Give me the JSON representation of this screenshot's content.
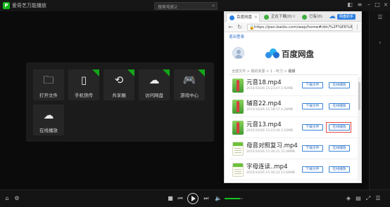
{
  "player": {
    "title": "爱奇艺万能播放",
    "title_caret": "⌄",
    "search_placeholder": "搜索电影2",
    "tiles": [
      {
        "label": "打开文件",
        "icon": "🗀",
        "new": false
      },
      {
        "label": "手机快传",
        "icon": "▯",
        "new": true
      },
      {
        "label": "共享圈",
        "icon": "⟲",
        "new": true
      },
      {
        "label": "访问网盘",
        "icon": "☁",
        "new": true
      },
      {
        "label": "游戏中心",
        "icon": "🎮",
        "new": true
      },
      {
        "label": "在线播放",
        "icon": "☁",
        "new": false
      }
    ]
  },
  "browser": {
    "tabs": [
      {
        "label": "百度网盘",
        "active": true
      },
      {
        "label": "正在下载(0)",
        "active": false
      },
      {
        "label": "已有(0)",
        "active": false
      }
    ],
    "brand_tag": "网盘助手",
    "url": "https://pan.baidu.com/wap/home#/dir/%2F%E6%88%91",
    "logout": "退出登录",
    "logo_text": "百度网盘",
    "breadcrumb": {
      "items": [
        "全部文件",
        "我的资源",
        "1 - 听力"
      ],
      "current": "视频"
    },
    "download_label": "下载文件",
    "play_label": "在线播放",
    "files": [
      {
        "name": "元音18.mp4",
        "meta": "2015/10/26 15:23:47   2.92MB",
        "thumb": "green"
      },
      {
        "name": "辅音22.mp4",
        "meta": "2015/10/26 15:18:17   4.28MB",
        "thumb": "green"
      },
      {
        "name": "元音13.mp4",
        "meta": "2015/10/26 15:23:34   2.16MB",
        "thumb": "green"
      },
      {
        "name": "母音对照复习.mp4",
        "meta": "2015/10/26 15:30:31   21.08MB",
        "thumb": "page"
      },
      {
        "name": "字母连读..mp4",
        "meta": "2015/10/26 15:30:23   11.66MB",
        "thumb": "page"
      }
    ]
  },
  "controls": {
    "volume_level": 0.85
  },
  "colors": {
    "brand_green": "#15b51b",
    "baidu_blue": "#2b7fe0",
    "highlight_red": "#e24a4a"
  }
}
